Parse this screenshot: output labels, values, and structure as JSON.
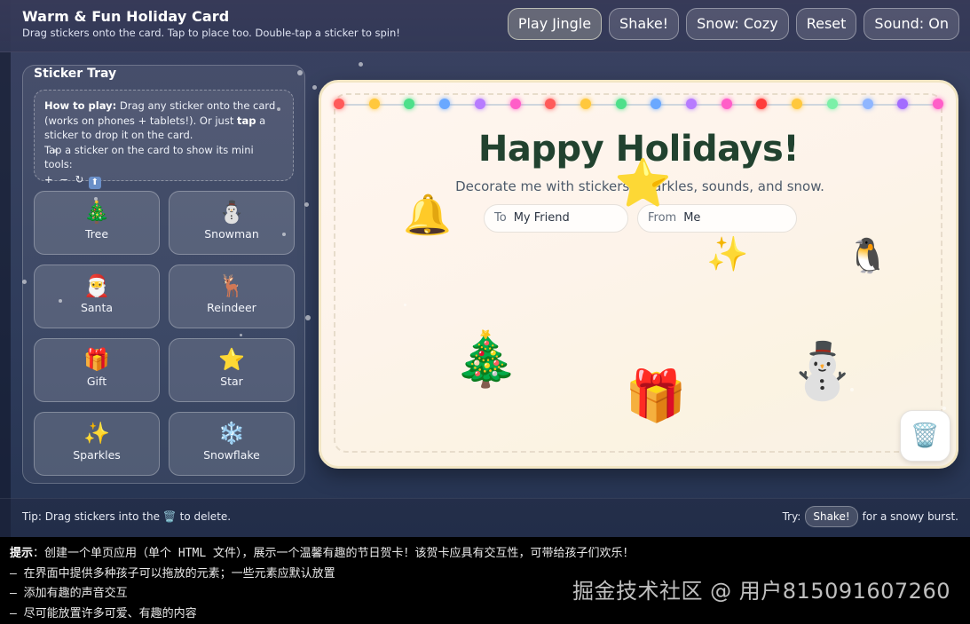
{
  "header": {
    "title": "Warm & Fun Holiday Card",
    "subtitle": "Drag stickers onto the card. Tap to place too. Double-tap a sticker to spin!",
    "buttons": {
      "play_jingle": "Play Jingle",
      "shake": "Shake!",
      "snow": "Snow: Cozy",
      "reset": "Reset",
      "sound": "Sound: On"
    }
  },
  "tray": {
    "title": "Sticker Tray",
    "howto": {
      "lead": "How to play:",
      "text1": " Drag any sticker onto the card (works on phones + tablets!). Or just ",
      "tap_word": "tap",
      "text2": " a sticker to drop it on the card.",
      "line2": "Tap a sticker on the card to show its mini tools:",
      "tools": "+ − ↻",
      "tools_up": "⬆"
    },
    "stickers": [
      {
        "emoji": "🎄",
        "label": "Tree"
      },
      {
        "emoji": "⛄",
        "label": "Snowman"
      },
      {
        "emoji": "🎅",
        "label": "Santa"
      },
      {
        "emoji": "🦌",
        "label": "Reindeer"
      },
      {
        "emoji": "🎁",
        "label": "Gift"
      },
      {
        "emoji": "⭐",
        "label": "Star"
      },
      {
        "emoji": "✨",
        "label": "Sparkles"
      },
      {
        "emoji": "❄️",
        "label": "Snowflake"
      }
    ]
  },
  "card": {
    "title": "Happy Holidays!",
    "subtitle": "Decorate me with stickers, sparkles, sounds, and snow.",
    "to_label": "To",
    "to_value": "My Friend",
    "from_label": "From",
    "from_value": "Me",
    "light_colors": [
      "#ff5a5a",
      "#ffc83d",
      "#4de08a",
      "#6aa8ff",
      "#b77bff",
      "#ff5ec8",
      "#ff5a5a",
      "#ffc83d",
      "#4de08a",
      "#6aa8ff",
      "#b77bff",
      "#ff5ec8",
      "#ff3b3b",
      "#ffc83d",
      "#7bf0a8",
      "#8fb6ff",
      "#a36bff",
      "#ff5ec8"
    ],
    "placed_stickers": {
      "bell": "🔔",
      "star": "⭐",
      "sparkles": "✨",
      "penguin": "🐧",
      "tree": "🎄",
      "gift": "🎁",
      "snowman": "⛄"
    },
    "trash_icon": "🗑️"
  },
  "footer": {
    "tip_before": "Tip: Drag stickers into the ",
    "tip_icon": "🗑️",
    "tip_after": " to delete.",
    "try_label": "Try:",
    "try_button": "Shake!",
    "try_after": "for a snowy burst."
  },
  "prompt": {
    "label": "提示",
    "line1": "：创建一个单页应用（单个 HTML 文件），展示一个温馨有趣的节日贺卡！该贺卡应具有交互性，可带给孩子们欢乐！",
    "line2": "– 在界面中提供多种孩子可以拖放的元素；一些元素应默认放置",
    "line3": "– 添加有趣的声音交互",
    "line4": "– 尽可能放置许多可爱、有趣的内容"
  },
  "watermark": "掘金技术社区 @ 用户815091607260"
}
